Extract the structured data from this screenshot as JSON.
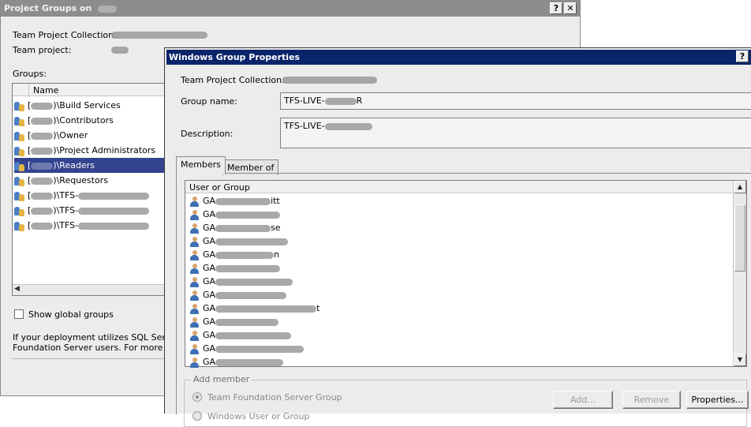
{
  "project_groups_window": {
    "title": "Project Groups on",
    "help_button": "?",
    "close_button": "✕",
    "collection_label": "Team Project Collection:",
    "project_label": "Team project:",
    "groups_label": "Groups:",
    "column_name": "Name",
    "groups": [
      {
        "suffix": ")\\Build Services",
        "selected": false
      },
      {
        "suffix": ")\\Contributors",
        "selected": false
      },
      {
        "suffix": ")\\Owner",
        "selected": false
      },
      {
        "suffix": ")\\Project Administrators",
        "selected": false
      },
      {
        "suffix": ")\\Readers",
        "selected": true
      },
      {
        "suffix": ")\\Requestors",
        "selected": false
      },
      {
        "suffix": ")\\TFS-",
        "selected": false
      },
      {
        "suffix": ")\\TFS-",
        "selected": false
      },
      {
        "suffix": ")\\TFS-",
        "selected": false
      }
    ],
    "show_global_groups": "Show global groups",
    "info_line1": "If your deployment utilizes SQL Server R",
    "info_line2": "Foundation Server users. For more infor"
  },
  "windows_group_properties": {
    "title": "Windows Group Properties",
    "help_button": "?",
    "collection_label": "Team Project Collection:",
    "group_name_label": "Group name:",
    "group_name_value": "TFS-LIVE-",
    "group_name_tail": "R",
    "description_label": "Description:",
    "description_value": "TFS-LIVE-",
    "tabs": [
      "Members",
      "Member of"
    ],
    "active_tab": "Members",
    "members_column": "User or Group",
    "members": [
      {
        "prefix": "GA",
        "visible": "itt"
      },
      {
        "prefix": "GA",
        "visible": ""
      },
      {
        "prefix": "GA",
        "visible": "se"
      },
      {
        "prefix": "GA",
        "visible": ""
      },
      {
        "prefix": "GA",
        "visible": "n"
      },
      {
        "prefix": "GA",
        "visible": ""
      },
      {
        "prefix": "GA",
        "visible": ""
      },
      {
        "prefix": "GA",
        "visible": ""
      },
      {
        "prefix": "GA",
        "visible": "t"
      },
      {
        "prefix": "GA",
        "visible": ""
      },
      {
        "prefix": "GA",
        "visible": ""
      },
      {
        "prefix": "GA",
        "visible": ""
      },
      {
        "prefix": "GA",
        "visible": ""
      }
    ],
    "add_member_label": "Add member",
    "radio_tfs_group": "Team Foundation Server Group",
    "radio_windows": "Windows User or Group",
    "add_button": "Add...",
    "remove_button": "Remove",
    "properties_button": "Properties..."
  },
  "colors": {
    "dialog_title_bg": "#0a246a",
    "selection_bg": "#33438f",
    "inactive_title_bg": "#8d8d8d"
  }
}
